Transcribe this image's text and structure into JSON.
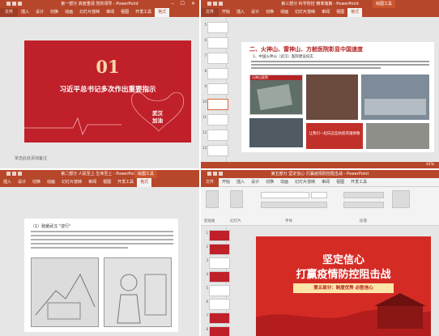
{
  "pane1": {
    "title": "第一部分 高度重视 党的领导 - PowerPoint",
    "tabs": [
      "文件",
      "插入",
      "设计",
      "切换",
      "动画",
      "幻灯片放映",
      "审阅",
      "视图",
      "开发工具",
      "格式"
    ],
    "slide": {
      "number": "01",
      "title": "习近平总书记多次作出重要指示",
      "badge_line1": "武汉",
      "badge_line2": "加油"
    },
    "notes_placeholder": "单击此处添加备注",
    "colors": {
      "accent": "#b7472a",
      "slide_bg": "#c0202a"
    }
  },
  "pane2": {
    "title": "第三部分 科学防控 精准施策 - PowerPoint",
    "context_tab": "绘图工具",
    "tabs": [
      "文件",
      "开始",
      "插入",
      "设计",
      "切换",
      "动画",
      "幻灯片放映",
      "审阅",
      "视图",
      "格式"
    ],
    "thumb_numbers": [
      "5",
      "6",
      "7",
      "8",
      "9",
      "10",
      "11",
      "12",
      "13"
    ],
    "slide": {
      "heading": "二、火神山、雷神山、方舱医院彰显中国速度",
      "subheading": "1、中国火神山（武汉）医院建设纪实",
      "photo_label": "火神山医院",
      "banner": "让我们一起向这些抗疫英雄致敬"
    },
    "status_zoom": "42%"
  },
  "pane3": {
    "title": "第二部分 人民至上 生命至上 - PowerPoint",
    "context_tab": "绘图工具",
    "tabs": [
      "插入",
      "设计",
      "切换",
      "动画",
      "幻灯片放映",
      "审阅",
      "视图",
      "开发工具",
      "格式"
    ],
    "slide": {
      "heading": "（1）驰援武汉 \"逆行\"",
      "paragraph": "……"
    }
  },
  "pane4": {
    "title": "第五部分 坚定信心 打赢疫情防控阻击战 - PowerPoint",
    "tabs": [
      "文件",
      "开始",
      "插入",
      "设计",
      "切换",
      "动画",
      "幻灯片放映",
      "审阅",
      "视图",
      "开发工具"
    ],
    "groups": [
      "剪贴板",
      "幻灯片",
      "字体",
      "段落"
    ],
    "thumb_numbers": [
      "1",
      "2",
      "3",
      "4",
      "5",
      "6",
      "7",
      "8"
    ],
    "slide": {
      "title_line1": "坚定信心",
      "title_line2": "打赢疫情防控阻击战",
      "part_label": "第五部分：制度优势 必胜信心"
    }
  }
}
